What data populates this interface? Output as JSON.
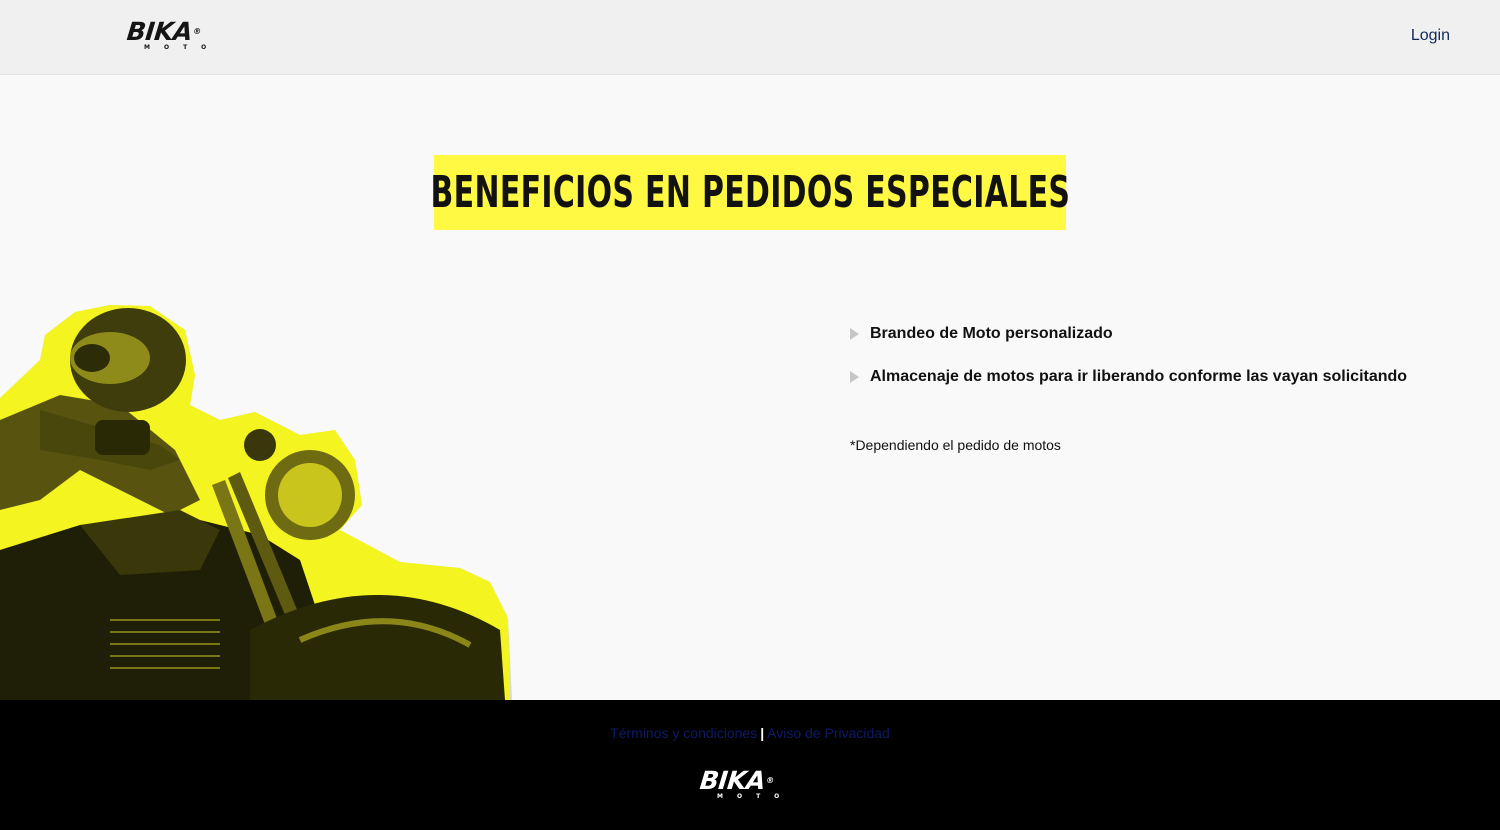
{
  "header": {
    "logo": {
      "word": "BIKA",
      "reg": "®",
      "sub": "MOTO"
    },
    "login_label": "Login"
  },
  "main": {
    "title": "BENEFICIOS EN PEDIDOS ESPECIALES",
    "benefits": [
      {
        "label": "Brandeo de Moto personalizado"
      },
      {
        "label": "Almacenaje de motos para ir liberando conforme las vayan solicitando"
      }
    ],
    "note": "*Dependiendo el pedido de motos"
  },
  "footer": {
    "links": {
      "terms": "Términos y condiciones",
      "separator": "|",
      "privacy": "Aviso de Privacidad"
    },
    "logo": {
      "word": "BIKA",
      "reg": "®",
      "sub": "MOTO"
    }
  },
  "colors": {
    "accent_yellow": "#fff944",
    "header_bg": "#f0f0f0",
    "footer_bg": "#000000",
    "link_dark_blue": "#0f1a66",
    "login_blue": "#102a5a"
  }
}
